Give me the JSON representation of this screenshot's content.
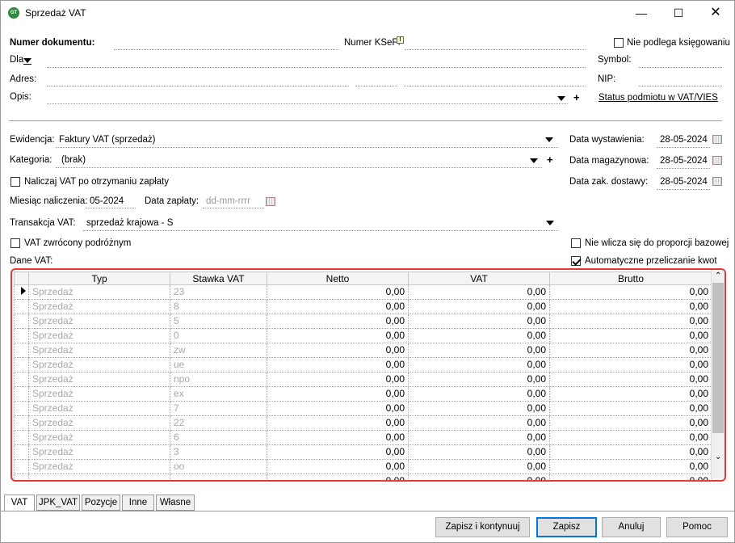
{
  "window": {
    "title": "Sprzedaż VAT"
  },
  "header": {
    "numer_dokumentu_label": "Numer dokumentu:",
    "numer_ksef_label": "Numer KSeF:",
    "nie_podlega_label": "Nie podlega księgowaniu",
    "dla_label": "Dla",
    "symbol_label": "Symbol:",
    "adres_label": "Adres:",
    "nip_label": "NIP:",
    "opis_label": "Opis:",
    "status_link": "Status podmiotu w VAT/VIES"
  },
  "form": {
    "ewidencja_label": "Ewidencja:",
    "ewidencja_value": "Faktury VAT (sprzedaż)",
    "kategoria_label": "Kategoria:",
    "kategoria_value": "(brak)",
    "naliczaj_label": "Naliczaj VAT po otrzymaniu zapłaty",
    "miesiac_label": "Miesiąc naliczenia:",
    "miesiac_value": "05-2024",
    "data_zaplaty_label": "Data zapłaty:",
    "data_zaplaty_placeholder": "dd-mm-rrrr",
    "transakcja_label": "Transakcja VAT:",
    "transakcja_value": "sprzedaż krajowa - S",
    "vat_zwrocony_label": "VAT zwrócony podróżnym",
    "dane_vat_label": "Dane VAT:",
    "data_wystawienia_label": "Data wystawienia:",
    "data_wystawienia_value": "28-05-2024",
    "data_magazynowa_label": "Data magazynowa:",
    "data_magazynowa_value": "28-05-2024",
    "data_dostawy_label": "Data zak. dostawy:",
    "data_dostawy_value": "28-05-2024",
    "nie_wlicza_label": "Nie wlicza się do proporcji bazowej",
    "auto_label": "Automatyczne przeliczanie kwot",
    "auto_checked": true
  },
  "grid": {
    "headers": [
      "Typ",
      "Stawka VAT",
      "Netto",
      "VAT",
      "Brutto"
    ],
    "rows": [
      {
        "typ": "Sprzedaż",
        "stawka": "23",
        "netto": "0,00",
        "vat": "0,00",
        "brutto": "0,00"
      },
      {
        "typ": "Sprzedaż",
        "stawka": "8",
        "netto": "0,00",
        "vat": "0,00",
        "brutto": "0,00"
      },
      {
        "typ": "Sprzedaż",
        "stawka": "5",
        "netto": "0,00",
        "vat": "0,00",
        "brutto": "0,00"
      },
      {
        "typ": "Sprzedaż",
        "stawka": "0",
        "netto": "0,00",
        "vat": "0,00",
        "brutto": "0,00"
      },
      {
        "typ": "Sprzedaż",
        "stawka": "zw",
        "netto": "0,00",
        "vat": "0,00",
        "brutto": "0,00"
      },
      {
        "typ": "Sprzedaż",
        "stawka": "ue",
        "netto": "0,00",
        "vat": "0,00",
        "brutto": "0,00"
      },
      {
        "typ": "Sprzedaż",
        "stawka": "npo",
        "netto": "0,00",
        "vat": "0,00",
        "brutto": "0,00"
      },
      {
        "typ": "Sprzedaż",
        "stawka": "ex",
        "netto": "0,00",
        "vat": "0,00",
        "brutto": "0,00"
      },
      {
        "typ": "Sprzedaż",
        "stawka": "7",
        "netto": "0,00",
        "vat": "0,00",
        "brutto": "0,00"
      },
      {
        "typ": "Sprzedaż",
        "stawka": "22",
        "netto": "0,00",
        "vat": "0,00",
        "brutto": "0,00"
      },
      {
        "typ": "Sprzedaż",
        "stawka": "6",
        "netto": "0,00",
        "vat": "0,00",
        "brutto": "0,00"
      },
      {
        "typ": "Sprzedaż",
        "stawka": "3",
        "netto": "0,00",
        "vat": "0,00",
        "brutto": "0,00"
      },
      {
        "typ": "Sprzedaż",
        "stawka": "oo",
        "netto": "0,00",
        "vat": "0,00",
        "brutto": "0,00"
      }
    ],
    "totals": {
      "netto": "0,00",
      "vat": "0,00",
      "brutto": "0,00"
    }
  },
  "tabs": [
    "VAT",
    "JPK_VAT",
    "Pozycje",
    "Inne",
    "Własne"
  ],
  "buttons": {
    "zapisz_kontynuuj": "Zapisz i kontynuuj",
    "zapisz": "Zapisz",
    "anuluj": "Anuluj",
    "pomoc": "Pomoc"
  },
  "colors": {
    "highlight_border": "#e53935",
    "default_button": "#0078d7"
  }
}
